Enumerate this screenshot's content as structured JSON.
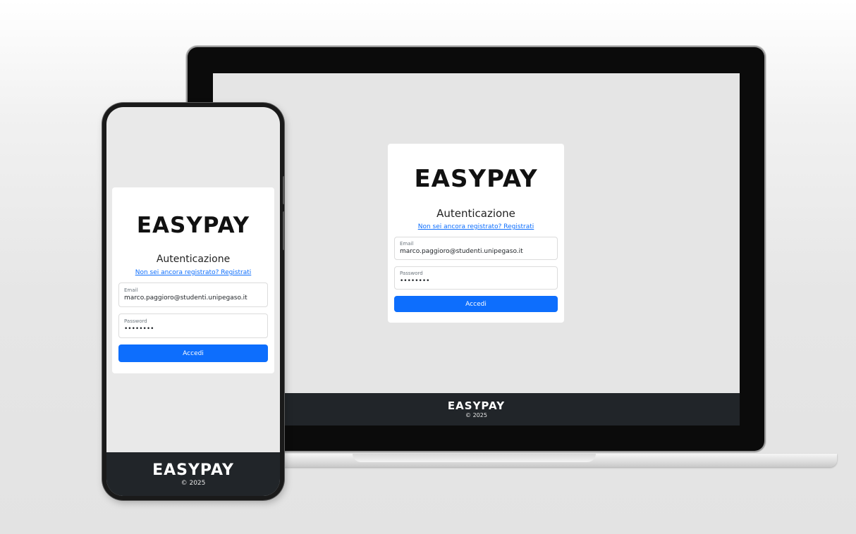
{
  "brand": {
    "logo_text": "EASYPAY"
  },
  "login": {
    "title": "Autenticazione",
    "register_link": "Non sei ancora registrato? Registrati",
    "email_label": "Email",
    "email_value": "marco.paggioro@studenti.unipegaso.it",
    "password_label": "Password",
    "password_value": "••••••••",
    "submit_label": "Accedi"
  },
  "footer": {
    "logo_text": "EASYPAY",
    "copyright": "© 2025"
  },
  "colors": {
    "primary": "#0d6efd",
    "footer_bg": "#212529",
    "screen_bg": "#e5e5e5",
    "card_bg": "#ffffff"
  }
}
